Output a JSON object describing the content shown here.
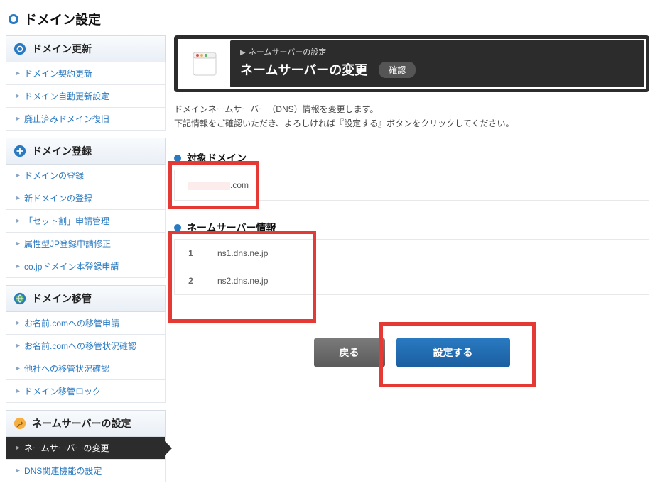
{
  "page_title": "ドメイン設定",
  "sidebar": {
    "groups": [
      {
        "id": "update",
        "label": "ドメイン更新",
        "icon": "refresh",
        "items": [
          {
            "id": "contract-renew",
            "label": "ドメイン契約更新"
          },
          {
            "id": "auto-renew",
            "label": "ドメイン自動更新設定"
          },
          {
            "id": "restore",
            "label": "廃止済みドメイン復旧"
          }
        ]
      },
      {
        "id": "register",
        "label": "ドメイン登録",
        "icon": "plus",
        "items": [
          {
            "id": "reg",
            "label": "ドメインの登録"
          },
          {
            "id": "new-reg",
            "label": "新ドメインの登録"
          },
          {
            "id": "set-discount",
            "label": "「セット割」申請管理"
          },
          {
            "id": "jp-attr",
            "label": "属性型JP登録申請修正"
          },
          {
            "id": "cojp",
            "label": "co.jpドメイン本登録申請"
          }
        ]
      },
      {
        "id": "transfer",
        "label": "ドメイン移管",
        "icon": "globe",
        "items": [
          {
            "id": "onamae-apply",
            "label": "お名前.comへの移管申請"
          },
          {
            "id": "onamae-status",
            "label": "お名前.comへの移管状況確認"
          },
          {
            "id": "other-status",
            "label": "他社への移管状況確認"
          },
          {
            "id": "lock",
            "label": "ドメイン移管ロック"
          }
        ]
      },
      {
        "id": "nameserver",
        "label": "ネームサーバーの設定",
        "icon": "wrench",
        "items": [
          {
            "id": "ns-change",
            "label": "ネームサーバーの変更",
            "active": true
          },
          {
            "id": "dns-related",
            "label": "DNS関連機能の設定"
          }
        ]
      }
    ]
  },
  "card": {
    "breadcrumb": "ネームサーバーの設定",
    "title": "ネームサーバーの変更",
    "badge": "確認"
  },
  "description": {
    "line1": "ドメインネームサーバー（DNS）情報を変更します。",
    "line2": "下記情報をご確認いただき、よろしければ『設定する』ボタンをクリックしてください。"
  },
  "sections": {
    "target_domain": {
      "title": "対象ドメイン",
      "value_suffix": ".com"
    },
    "nameservers": {
      "title": "ネームサーバー情報",
      "rows": [
        {
          "index": "1",
          "value": "ns1.dns.ne.jp"
        },
        {
          "index": "2",
          "value": "ns2.dns.ne.jp"
        }
      ]
    }
  },
  "actions": {
    "back": "戻る",
    "submit": "設定する"
  }
}
